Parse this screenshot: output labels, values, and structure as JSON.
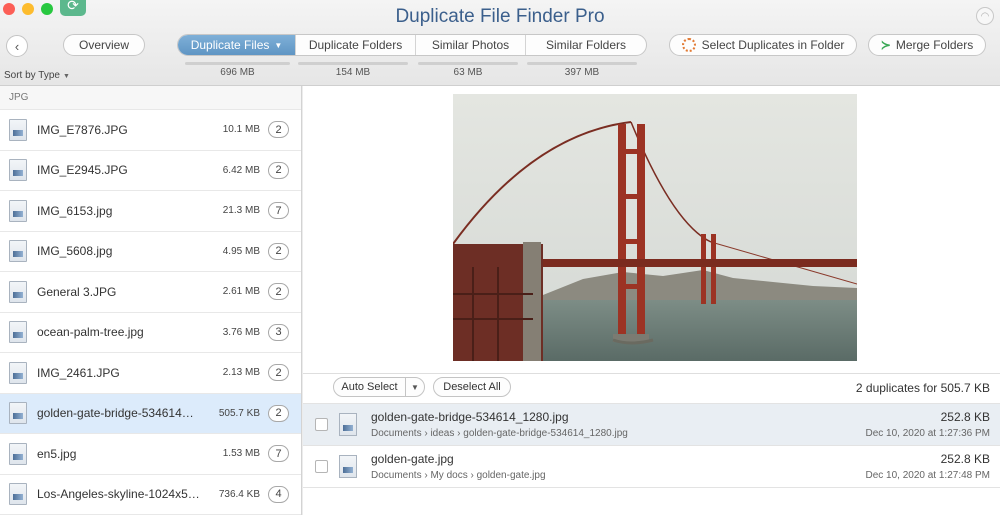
{
  "window": {
    "title": "Duplicate File Finder Pro"
  },
  "toolbar": {
    "overview_label": "Overview",
    "tabs": [
      {
        "label": "Duplicate Files",
        "size": "696 MB",
        "active": true
      },
      {
        "label": "Duplicate Folders",
        "size": "154 MB",
        "active": false
      },
      {
        "label": "Similar Photos",
        "size": "63 MB",
        "active": false
      },
      {
        "label": "Similar Folders",
        "size": "397 MB",
        "active": false
      }
    ],
    "select_duplicates_label": "Select Duplicates in Folder",
    "merge_folders_label": "Merge Folders",
    "sort_label": "Sort by Type"
  },
  "sidebar": {
    "group": "JPG",
    "files": [
      {
        "name": "IMG_E7876.JPG",
        "size": "10.1 MB",
        "count": "2"
      },
      {
        "name": "IMG_E2945.JPG",
        "size": "6.42 MB",
        "count": "2"
      },
      {
        "name": "IMG_6153.jpg",
        "size": "21.3 MB",
        "count": "7"
      },
      {
        "name": "IMG_5608.jpg",
        "size": "4.95 MB",
        "count": "2"
      },
      {
        "name": "General 3.JPG",
        "size": "2.61 MB",
        "count": "2"
      },
      {
        "name": "ocean-palm-tree.jpg",
        "size": "3.76 MB",
        "count": "3"
      },
      {
        "name": "IMG_2461.JPG",
        "size": "2.13 MB",
        "count": "2"
      },
      {
        "name": "golden-gate-bridge-534614_1...",
        "size": "505.7 KB",
        "count": "2"
      },
      {
        "name": "en5.jpg",
        "size": "1.53 MB",
        "count": "7"
      },
      {
        "name": "Los-Angeles-skyline-1024x57...",
        "size": "736.4 KB",
        "count": "4"
      }
    ]
  },
  "main": {
    "auto_select_label": "Auto Select",
    "deselect_all_label": "Deselect All",
    "summary": "2 duplicates for 505.7 KB",
    "duplicates": [
      {
        "name": "golden-gate-bridge-534614_1280.jpg",
        "path": "Documents  ›  ideas  ›  golden-gate-bridge-534614_1280.jpg",
        "size": "252.8 KB",
        "date": "Dec 10, 2020 at 1:27:36 PM"
      },
      {
        "name": "golden-gate.jpg",
        "path": "Documents  ›  My docs  ›  golden-gate.jpg",
        "size": "252.8 KB",
        "date": "Dec 10, 2020 at 1:27:48 PM"
      }
    ]
  },
  "colors": {
    "title": "#3b5f8c",
    "active_tab": "#6ea3cf",
    "selected_row": "#dcebfb"
  }
}
